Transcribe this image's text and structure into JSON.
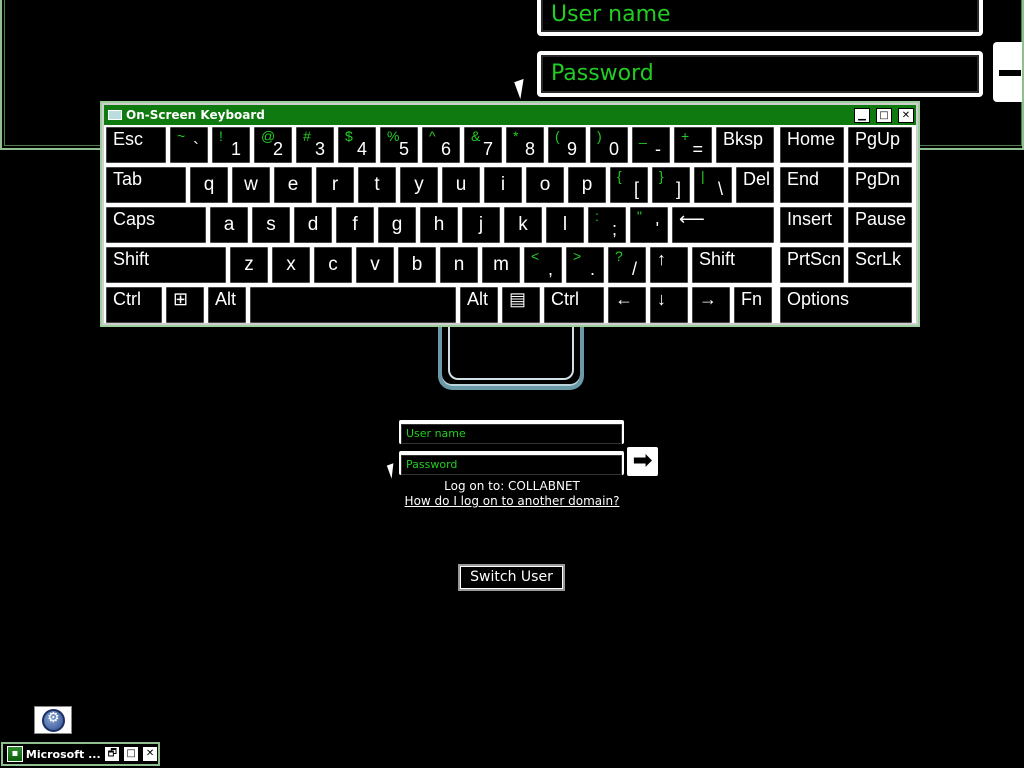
{
  "magnifier": {
    "username_text": "User name",
    "password_text": "Password"
  },
  "login": {
    "username_placeholder": "User name",
    "password_placeholder": "Password",
    "go_symbol": "➡",
    "logon_to": "Log on to: COLLABNET",
    "other_domain_link": "How do I log on to another domain?",
    "switch_user": "Switch User"
  },
  "osk": {
    "title": "On-Screen Keyboard",
    "window_buttons": [
      "▁",
      "□",
      "✕"
    ],
    "rows": [
      [
        {
          "main": "Esc"
        },
        {
          "shift": "~",
          "low": "`"
        },
        {
          "shift": "!",
          "low": "1"
        },
        {
          "shift": "@",
          "low": "2"
        },
        {
          "shift": "#",
          "low": "3"
        },
        {
          "shift": "$",
          "low": "4"
        },
        {
          "shift": "%",
          "low": "5"
        },
        {
          "shift": "^",
          "low": "6"
        },
        {
          "shift": "&",
          "low": "7"
        },
        {
          "shift": "*",
          "low": "8"
        },
        {
          "shift": "(",
          "low": "9"
        },
        {
          "shift": ")",
          "low": "0"
        },
        {
          "shift": "_",
          "low": "-"
        },
        {
          "shift": "+",
          "low": "="
        },
        {
          "main": "Bksp"
        },
        {
          "main": "Home"
        },
        {
          "main": "PgUp"
        }
      ],
      [
        {
          "main": "Tab"
        },
        {
          "ctr": "q"
        },
        {
          "ctr": "w"
        },
        {
          "ctr": "e"
        },
        {
          "ctr": "r"
        },
        {
          "ctr": "t"
        },
        {
          "ctr": "y"
        },
        {
          "ctr": "u"
        },
        {
          "ctr": "i"
        },
        {
          "ctr": "o"
        },
        {
          "ctr": "p"
        },
        {
          "shift": "{",
          "low": "["
        },
        {
          "shift": "}",
          "low": "]"
        },
        {
          "shift": "|",
          "low": "\\"
        },
        {
          "main": "Del"
        },
        {
          "main": "End"
        },
        {
          "main": "PgDn"
        }
      ],
      [
        {
          "main": "Caps"
        },
        {
          "ctr": "a"
        },
        {
          "ctr": "s"
        },
        {
          "ctr": "d"
        },
        {
          "ctr": "f"
        },
        {
          "ctr": "g"
        },
        {
          "ctr": "h"
        },
        {
          "ctr": "j"
        },
        {
          "ctr": "k"
        },
        {
          "ctr": "l"
        },
        {
          "shift": ":",
          "low": ";"
        },
        {
          "shift": "\"",
          "low": "'"
        },
        {
          "main": "⟵"
        },
        {
          "main": "Insert"
        },
        {
          "main": "Pause"
        }
      ],
      [
        {
          "main": "Shift"
        },
        {
          "ctr": "z"
        },
        {
          "ctr": "x"
        },
        {
          "ctr": "c"
        },
        {
          "ctr": "v"
        },
        {
          "ctr": "b"
        },
        {
          "ctr": "n"
        },
        {
          "ctr": "m"
        },
        {
          "shift": "<",
          "low": ","
        },
        {
          "shift": ">",
          "low": "."
        },
        {
          "shift": "?",
          "low": "/"
        },
        {
          "main": "↑"
        },
        {
          "main": "Shift"
        },
        {
          "main": "PrtScn"
        },
        {
          "main": "ScrLk"
        }
      ],
      [
        {
          "main": "Ctrl"
        },
        {
          "main": "⊞"
        },
        {
          "main": "Alt"
        },
        {
          "main": ""
        },
        {
          "main": "Alt"
        },
        {
          "main": "▤"
        },
        {
          "main": "Ctrl"
        },
        {
          "main": "←"
        },
        {
          "main": "↓"
        },
        {
          "main": "→"
        },
        {
          "main": "Fn"
        },
        {
          "main": "Options"
        }
      ]
    ]
  },
  "taskbar": {
    "mini_title": "Microsoft ...",
    "mini_buttons": [
      "🗗",
      "□",
      "✕"
    ]
  },
  "accessibility": {
    "icon": "accessibility-icon"
  }
}
